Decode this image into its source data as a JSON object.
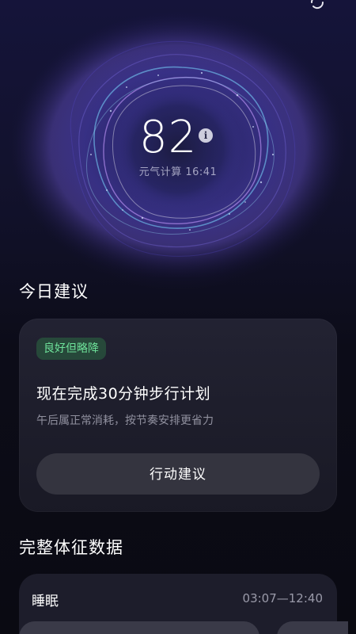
{
  "hero": {
    "score": "82",
    "info_label": "i",
    "caption": "元气计算 16:41"
  },
  "advice_section": {
    "title": "今日建议",
    "badge": "良好但略降",
    "headline": "现在完成30分钟步行计划",
    "description": "午后属正常消耗，按节奏安排更省力",
    "action_label": "行动建议"
  },
  "vitals_section": {
    "title": "完整体征数据",
    "sleep": {
      "label": "睡眠",
      "range": "03:07—12:40"
    }
  },
  "colors": {
    "badge_text": "#6ee19a",
    "badge_bg": "#28503c",
    "card_bg": "#242434",
    "button_bg": "#34343f"
  },
  "icons": {
    "refresh": "refresh-icon",
    "info": "info-icon"
  }
}
